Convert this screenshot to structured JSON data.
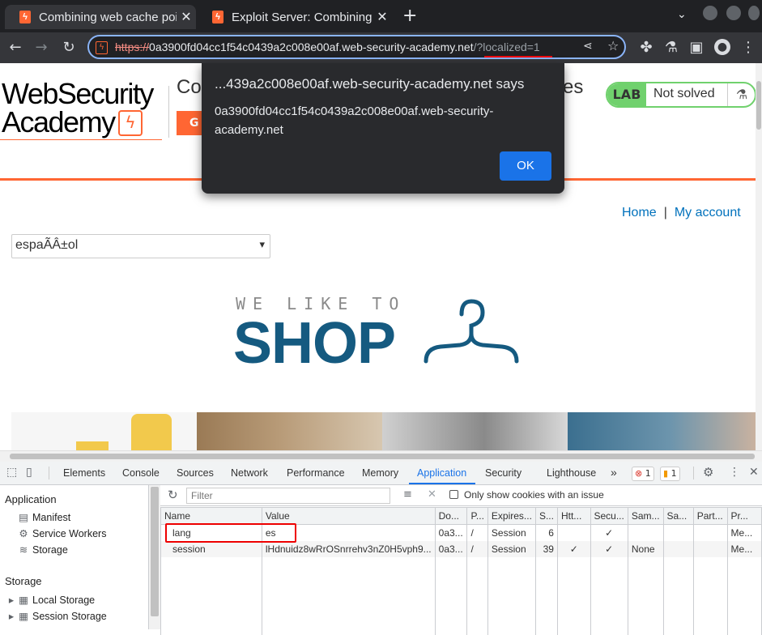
{
  "tabs": [
    {
      "title": "Combining web cache poi",
      "active": true
    },
    {
      "title": "Exploit Server: Combining",
      "active": false
    }
  ],
  "toolbar": {
    "url_scheme": "https://",
    "url_host": "0a3900fd04cc1f54c0439a2c008e00af.web-security-academy.net",
    "url_path": "/?localized=1"
  },
  "page": {
    "logo_line1": "WebSecurity",
    "logo_line2": "Academy",
    "title_fragment_left": "Co",
    "title_fragment_right": "es",
    "go_button": "G",
    "lab_tag": "LAB",
    "lab_status": "Not solved",
    "nav": {
      "home": "Home",
      "separator": "|",
      "account": "My account"
    },
    "lang_select_value": "espaÃÂ±ol",
    "tagline": "WE LIKE TO",
    "shop_word": "SHOP"
  },
  "dialog": {
    "title": "...439a2c008e00af.web-security-academy.net says",
    "message": "0a3900fd04cc1f54c0439a2c008e00af.web-security-academy.net",
    "ok_label": "OK"
  },
  "devtools": {
    "tabs": [
      "Elements",
      "Console",
      "Sources",
      "Network",
      "Performance",
      "Memory",
      "Application",
      "Security",
      "Lighthouse"
    ],
    "more_tabs": "»",
    "error_count": "1",
    "issue_count": "1",
    "sidebar": {
      "application_header": "Application",
      "application_items": [
        "Manifest",
        "Service Workers",
        "Storage"
      ],
      "storage_header": "Storage",
      "storage_items": [
        "Local Storage",
        "Session Storage"
      ]
    },
    "filter_placeholder": "Filter",
    "only_issue_label": "Only show cookies with an issue",
    "columns": [
      "Name",
      "Value",
      "Do...",
      "P...",
      "Expires...",
      "S...",
      "Htt...",
      "Secu...",
      "Sam...",
      "Sa...",
      "Part...",
      "Pr..."
    ],
    "cookies": [
      {
        "name": "lang",
        "value": "es",
        "domain": "0a3...",
        "path": "/",
        "expires": "Session",
        "size": "6",
        "httponly": "",
        "secure": "✓",
        "samesite": "",
        "sameparty": "",
        "partition": "",
        "priority": "Me..."
      },
      {
        "name": "session",
        "value": "lHdnuidz8wRrOSnrrehv3nZ0H5vph9...",
        "domain": "0a3...",
        "path": "/",
        "expires": "Session",
        "size": "39",
        "httponly": "✓",
        "secure": "✓",
        "samesite": "None",
        "sameparty": "",
        "partition": "",
        "priority": "Me..."
      }
    ]
  },
  "colors": {
    "accent_orange": "#ff6633",
    "lab_green": "#70d16d",
    "shop_blue": "#155a80",
    "link_blue": "#0071bc",
    "dialog_bg": "#292a2d",
    "ok_blue": "#1a73e8"
  }
}
